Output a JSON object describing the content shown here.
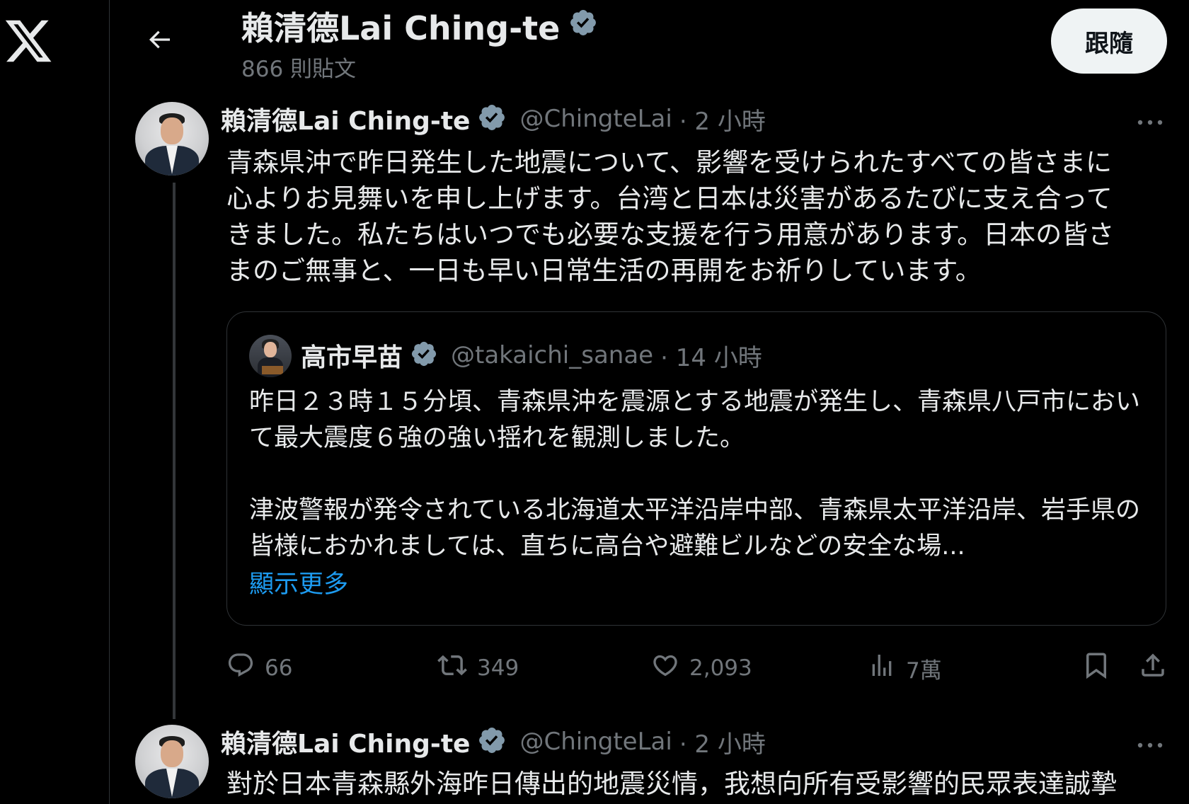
{
  "header": {
    "title": "賴清德Lai Ching-te",
    "post_count": "866 則貼文",
    "follow_label": "跟隨"
  },
  "tweets": [
    {
      "name": "賴清德Lai Ching-te",
      "handle": "@ChingteLai",
      "time": "· 2 小時",
      "text": "青森県沖で昨日発生した地震について、影響を受けられたすべての皆さまに\n心よりお見舞いを申し上げます。台湾と日本は災害があるたびに支え合って\nきました。私たちはいつでも必要な支援を行う用意があります。日本の皆さ\nまのご無事と、一日も早い日常生活の再開をお祈りしています。",
      "quote": {
        "name": "高市早苗",
        "handle": "@takaichi_sanae",
        "time": "· 14 小時",
        "paragraph1": "昨日２３時１５分頃、青森県沖を震源とする地震が発生し、青森県八戸市において最大震度６強の強い揺れを観測しました。",
        "paragraph2": "津波警報が発令されている北海道太平洋沿岸中部、青森県太平洋沿岸、岩手県の皆様におかれましては、直ちに高台や避難ビルなどの安全な場...",
        "show_more": "顯示更多"
      },
      "stats": {
        "replies": "66",
        "reposts": "349",
        "likes": "2,093",
        "views": "7萬"
      }
    },
    {
      "name": "賴清德Lai Ching-te",
      "handle": "@ChingteLai",
      "time": "· 2 小時",
      "text": "對於日本青森縣外海昨日傳出的地震災情，我想向所有受影響的民眾表達誠摯"
    }
  ],
  "colors": {
    "background": "#000000",
    "text": "#e7e9ea",
    "secondary": "#71767b",
    "link": "#1d9bf0",
    "verified": "#829aab",
    "border": "#2f3336"
  },
  "icons": [
    "x-logo-icon",
    "back-arrow-icon",
    "verified-badge-icon",
    "more-icon",
    "reply-icon",
    "repost-icon",
    "like-icon",
    "views-icon",
    "bookmark-icon",
    "share-icon"
  ]
}
